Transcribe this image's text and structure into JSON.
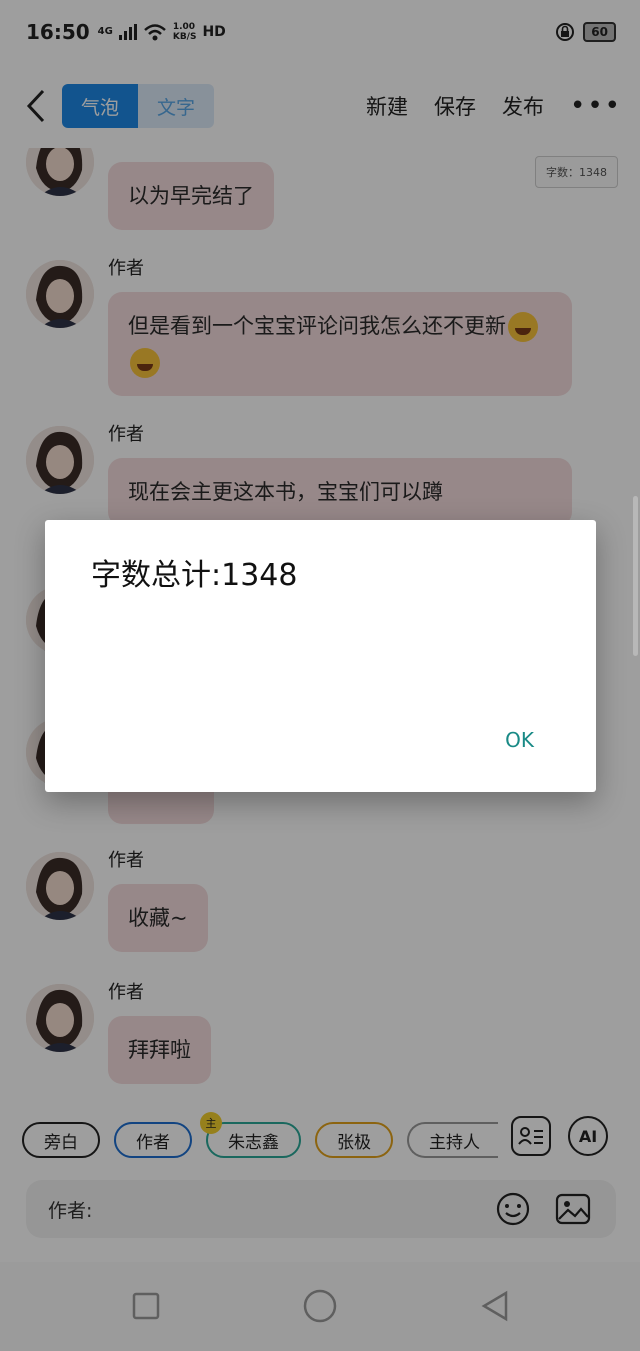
{
  "status": {
    "time": "16:50",
    "network": "4G",
    "speed_value": "1.00",
    "speed_unit": "KB/S",
    "hd": "HD",
    "battery": "60"
  },
  "toolbar": {
    "tab_bubble": "气泡",
    "tab_text": "文字",
    "new_label": "新建",
    "save_label": "保存",
    "publish_label": "发布",
    "more_label": "•••"
  },
  "word_count_badge": "字数：1348",
  "messages": [
    {
      "name": "",
      "text": "以为早完结了"
    },
    {
      "name": "作者",
      "text": "但是看到一个宝宝评论问我怎么还不更新"
    },
    {
      "name": "作者",
      "text": "现在会主更这本书，宝宝们可以蹲"
    },
    {
      "name": "作者",
      "text": "收藏~"
    },
    {
      "name": "作者",
      "text": "拜拜啦"
    }
  ],
  "roles": [
    "旁白",
    "作者",
    "朱志鑫",
    "张极",
    "主持人"
  ],
  "role_marker": "主",
  "ai_label": "AI",
  "input": {
    "prefix": "作者:"
  },
  "dialog": {
    "message": "字数总计:1348",
    "ok_label": "OK"
  },
  "colors": {
    "accent": "#1e88e5",
    "bubble": "#f4dcdd",
    "ok": "#198a86"
  }
}
